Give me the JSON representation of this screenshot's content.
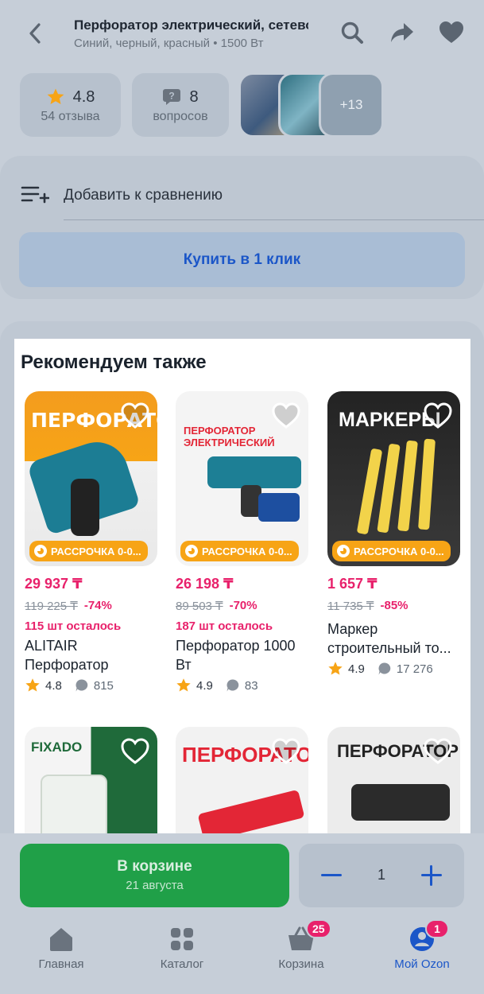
{
  "header": {
    "title": "Перфоратор электрический, сетевой",
    "subtitle": "Синий, черный, красный • 1500 Вт"
  },
  "stats": {
    "rating": "4.8",
    "reviews_label": "54 отзыва",
    "questions_count": "8",
    "questions_label": "вопросов",
    "more_photos": "+13"
  },
  "actions": {
    "compare_label": "Добавить к сравнению",
    "buy_one_click": "Купить в 1 клик"
  },
  "recommend": {
    "title": "Рекомендуем также",
    "badge_text": "РАССРОЧКА 0-0...",
    "items": [
      {
        "price": "29 937 ₸",
        "old_price": "119 225 ₸",
        "discount": "-74%",
        "stock_left": "115 шт осталось",
        "name": "ALITAIR Перфоратор элект...",
        "rating": "4.8",
        "reviews": "815",
        "image_text": "ПЕРФОРАТОР"
      },
      {
        "price": "26 198 ₸",
        "old_price": "89 503 ₸",
        "discount": "-70%",
        "stock_left": "187 шт осталось",
        "name": "Перфоратор 1000 Вт",
        "rating": "4.9",
        "reviews": "83",
        "image_text": "ПЕРФОРАТОР ЭЛЕКТРИЧЕСКИЙ"
      },
      {
        "price": "1 657 ₸",
        "old_price": "11 735 ₸",
        "discount": "-85%",
        "stock_left": "",
        "name": "Маркер строительный то...",
        "rating": "4.9",
        "reviews": "17 276",
        "image_text": "МАРКЕРЫ"
      },
      {
        "image_text": "FIXADO"
      },
      {
        "image_text": "ПЕРФОРАТОР"
      },
      {
        "image_text": "ПЕРФОРАТОР"
      }
    ]
  },
  "cart": {
    "in_cart_label": "В корзине",
    "delivery_date": "21 августа",
    "quantity": "1"
  },
  "tabbar": {
    "items": [
      {
        "label": "Главная"
      },
      {
        "label": "Каталог"
      },
      {
        "label": "Корзина",
        "badge": "25"
      },
      {
        "label": "Мой Ozon",
        "badge": "1"
      }
    ]
  },
  "colors": {
    "accent_blue": "#1b56c8",
    "price_pink": "#e8216b",
    "cart_green": "#20a048",
    "badge_orange": "#f7a416"
  }
}
